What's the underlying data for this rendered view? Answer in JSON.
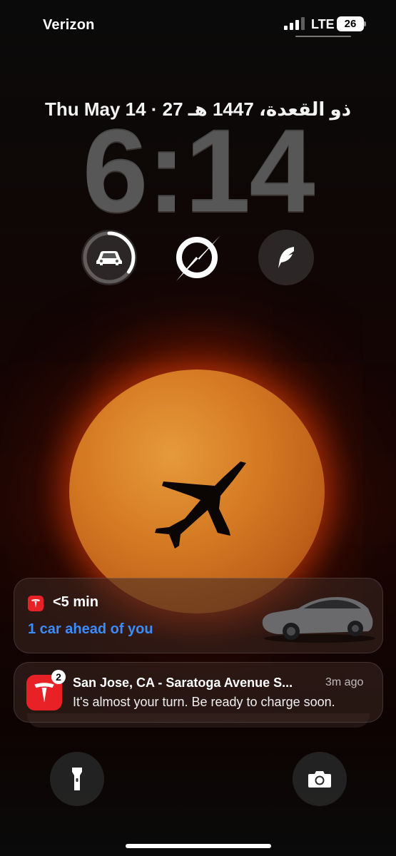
{
  "status_bar": {
    "carrier": "Verizon",
    "network": "LTE",
    "battery": "26",
    "signal_bars_filled": 3,
    "signal_bars_total": 4
  },
  "lock_screen": {
    "date": "Thu May 14 · 27 ذو القعدة، 1447 هـ",
    "time": "6:14"
  },
  "widgets": [
    {
      "icon": "car-icon",
      "progress": 0.35
    },
    {
      "icon": "orbit-icon"
    },
    {
      "icon": "feather-icon"
    }
  ],
  "live_activity": {
    "app_icon": "tesla-logo-icon",
    "eta": "<5 min",
    "queue": "1 car ahead of you"
  },
  "notification": {
    "app_icon": "tesla-logo-icon",
    "badge_count": "2",
    "title": "San Jose, CA - Saratoga Avenue S...",
    "time_ago": "3m ago",
    "body": "It's almost your turn. Be ready to charge soon."
  },
  "quick_actions": [
    {
      "icon": "flashlight-icon"
    },
    {
      "icon": "camera-icon"
    }
  ],
  "colors": {
    "tesla_red": "#e82127",
    "queue_blue": "#3a8cff",
    "sun_orange": "#d57a24"
  }
}
